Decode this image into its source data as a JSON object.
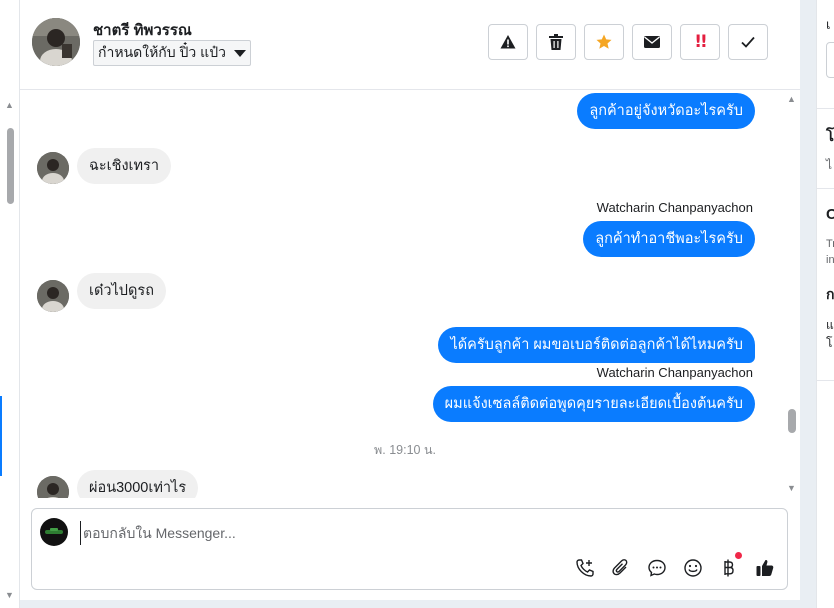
{
  "header": {
    "contact_name": "ชาตรี ทิพวรรณ",
    "assign_label": "กำหนดให้กับ ปิ๋ว แป๋ว",
    "actions": [
      {
        "name": "report-spam",
        "icon": "warning-icon"
      },
      {
        "name": "delete",
        "icon": "trash-icon"
      },
      {
        "name": "star",
        "icon": "star-icon"
      },
      {
        "name": "mark-unread",
        "icon": "envelope-icon"
      },
      {
        "name": "important",
        "icon": "double-exclamation-icon",
        "label": "!!"
      },
      {
        "name": "mark-done",
        "icon": "checkmark-icon"
      }
    ]
  },
  "messages": {
    "m1": {
      "text": "ลูกค้าอยู่จังหวัดอะไรครับ"
    },
    "m2": {
      "text": "ฉะเชิงเทรา"
    },
    "m3": {
      "sender": "Watcharin Chanpanyachon",
      "text": "ลูกค้าทำอาชีพอะไรครับ"
    },
    "m4": {
      "text": "เด๋วไปดูรถ"
    },
    "m5": {
      "text": "ได้ครับลูกค้า ผมขอเบอร์ติดต่อลูกค้าได้ไหมครับ"
    },
    "m6": {
      "sender": "Watcharin Chanpanyachon",
      "text": "ผมแจ้งเซลล์ติดต่อพูดคุยรายละเอียดเบื้องต้นครับ"
    },
    "timestamp": "พ. 19:10 น.",
    "m7": {
      "text": "ผ่อน3000เท่าไร"
    }
  },
  "composer": {
    "placeholder": "ตอบกลับใน Messenger...",
    "icons": [
      "phone-add-icon",
      "paperclip-icon",
      "saved-reply-icon",
      "emoji-icon",
      "baht-payment-icon",
      "thumbs-up-icon"
    ]
  },
  "colors": {
    "accent": "#0a7cff",
    "incoming_bubble": "#f0f0f0",
    "important": "#e41e3f",
    "star": "#f5a623",
    "notification_dot": "#f02849"
  },
  "right_panel": {
    "frag1": "เ",
    "frag2": "โ",
    "frag3": "ไ",
    "frag4": "C",
    "frag5": "Tr",
    "frag6": "in",
    "frag7": "ก",
    "frag8": "แ",
    "frag9": "โ"
  }
}
